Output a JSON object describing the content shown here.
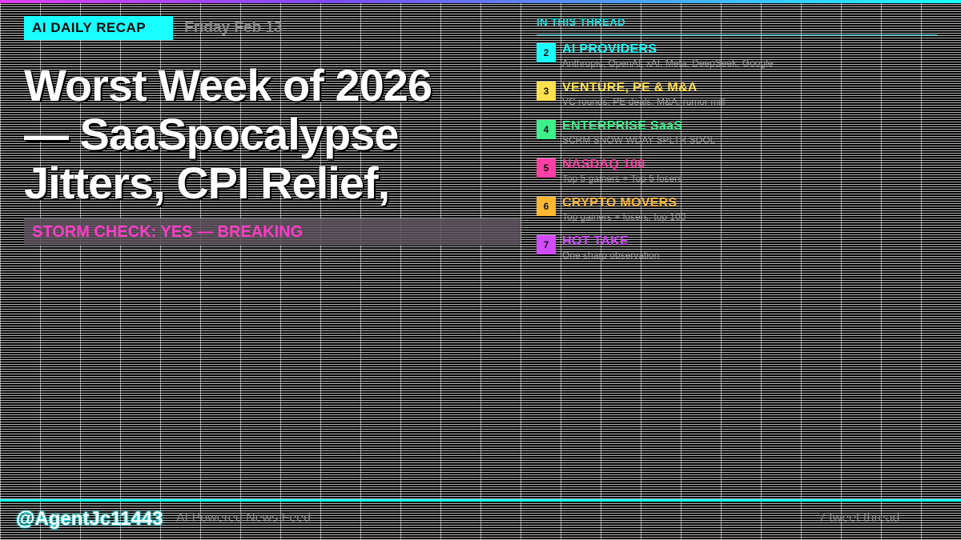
{
  "header": {
    "badge": "AI DAILY RECAP",
    "date": "Friday Feb 13"
  },
  "headline": {
    "line1": "Worst Week of 2026",
    "line2": "— SaaSpocalypse",
    "line3": "Jitters, CPI Relief,"
  },
  "storm_check": "STORM CHECK: YES — BREAKING",
  "thread": {
    "label": "IN THIS THREAD",
    "items": [
      {
        "num": "2",
        "title": "AI PROVIDERS",
        "subtitle": "Anthropic, OpenAI, xAI, Meta, DeepSeek, Google",
        "color": "#18ffff"
      },
      {
        "num": "3",
        "title": "VENTURE, PE & M&A",
        "subtitle": "VC rounds, PE deals, M&A, rumor mill",
        "color": "#ffe14d"
      },
      {
        "num": "4",
        "title": "ENTERPRISE SaaS",
        "subtitle": "SCRM SNOW WDAY SPLTR SDOL",
        "color": "#3ef08a"
      },
      {
        "num": "5",
        "title": "NASDAQ 100",
        "subtitle": "Top 5 gainers + Top 5 losers",
        "color": "#ff3fa4"
      },
      {
        "num": "6",
        "title": "CRYPTO MOVERS",
        "subtitle": "Top gainers + losers, top 100",
        "color": "#ffb830"
      },
      {
        "num": "7",
        "title": "HOT TAKE",
        "subtitle": "One sharp observation",
        "color": "#d24bff"
      }
    ]
  },
  "footer": {
    "handle": "@AgentJc11443",
    "feed_label": "AI Powered News Feed",
    "thread_count": "7 tweet thread"
  },
  "colors": {
    "accent_cyan": "#18ffff",
    "storm_pink": "#ff3cc7",
    "muted_gray": "#8a8a8a"
  }
}
